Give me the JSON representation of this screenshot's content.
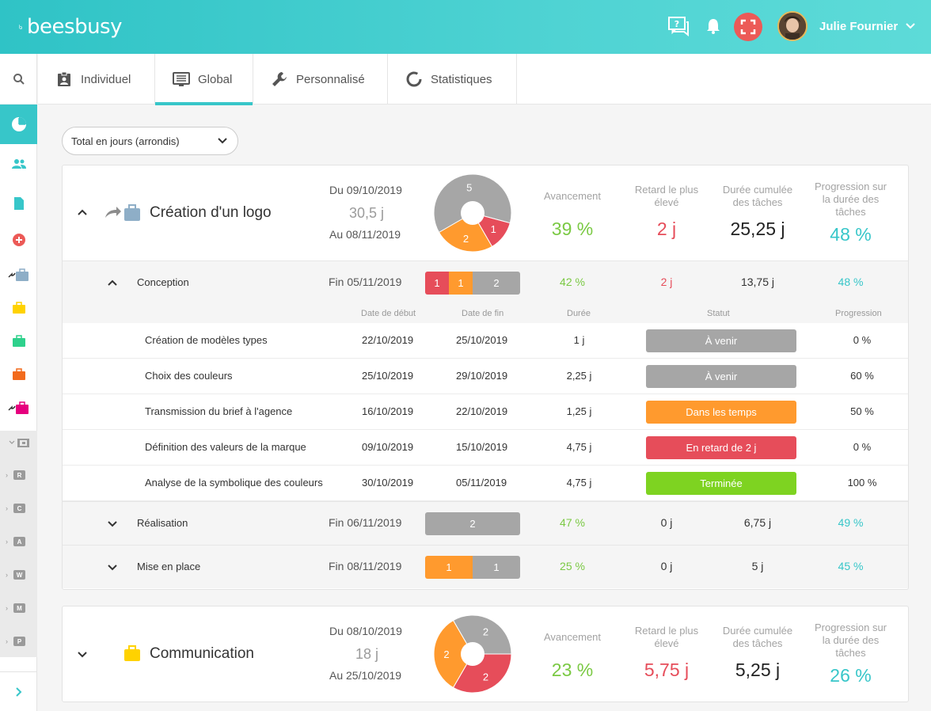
{
  "app": {
    "name": "beesbusy"
  },
  "user": {
    "name": "Julie Fournier"
  },
  "colors": {
    "accent": "#37c6c9",
    "green": "#7ac943",
    "red": "#e64d5a",
    "orange": "#ff9a2e",
    "gray": "#a6a6a6"
  },
  "tabs": [
    {
      "label": "Individuel",
      "icon": "clipboard-user-icon"
    },
    {
      "label": "Global",
      "icon": "list-screen-icon",
      "active": true
    },
    {
      "label": "Personnalisé",
      "icon": "wrench-icon"
    },
    {
      "label": "Statistiques",
      "icon": "donut-chart-icon"
    }
  ],
  "sidebar": {
    "letters": [
      "R",
      "C",
      "A",
      "W",
      "M",
      "P"
    ]
  },
  "filter": {
    "selected": "Total en jours (arrondis)"
  },
  "kpi_labels": {
    "avancement": "Avancement",
    "retard_line1": "Retard le plus",
    "retard_line2": "élevé",
    "duree_line1": "Durée cumulée",
    "duree_line2": "des tâches",
    "progression_line1": "Progression sur",
    "progression_line2": "la durée des",
    "progression_line3": "tâches"
  },
  "table_headers": {
    "start": "Date de début",
    "end": "Date de fin",
    "duration": "Durée",
    "status": "Statut",
    "progress": "Progression"
  },
  "projects": [
    {
      "name": "Création d'un logo",
      "date_start": "Du 09/10/2019",
      "duration": "30,5 j",
      "date_end": "Au 08/11/2019",
      "pie": [
        {
          "value": 5,
          "color": "#a6a6a6"
        },
        {
          "value": 1,
          "color": "#e64d5a"
        },
        {
          "value": 2,
          "color": "#ff9a2e"
        }
      ],
      "pie_labels": [
        "5",
        "1",
        "2"
      ],
      "avancement": "39 %",
      "retard": "2 j",
      "duree": "25,25 j",
      "progression": "48 %",
      "subprojects": [
        {
          "name": "Conception",
          "fin": "Fin 05/11/2019",
          "bar": [
            {
              "label": "1",
              "color": "#e64d5a"
            },
            {
              "label": "1",
              "color": "#ff9a2e"
            },
            {
              "label": "2",
              "color": "#a6a6a6"
            }
          ],
          "avancement": "42 %",
          "retard": "2 j",
          "duree": "13,75 j",
          "progression": "48 %",
          "tasks": [
            {
              "name": "Création de modèles types",
              "start": "22/10/2019",
              "end": "25/10/2019",
              "duration": "1 j",
              "status": "À venir",
              "status_color": "#a6a6a6",
              "progress": "0 %"
            },
            {
              "name": "Choix des couleurs",
              "start": "25/10/2019",
              "end": "29/10/2019",
              "duration": "2,25 j",
              "status": "À venir",
              "status_color": "#a6a6a6",
              "progress": "60 %"
            },
            {
              "name": "Transmission du brief à l'agence",
              "start": "16/10/2019",
              "end": "22/10/2019",
              "duration": "1,25 j",
              "status": "Dans les temps",
              "status_color": "#ff9a2e",
              "progress": "50 %"
            },
            {
              "name": "Définition des valeurs de la marque",
              "start": "09/10/2019",
              "end": "15/10/2019",
              "duration": "4,75 j",
              "status": "En retard de 2 j",
              "status_color": "#e64d5a",
              "progress": "0 %"
            },
            {
              "name": "Analyse de la symbolique des couleurs",
              "start": "30/10/2019",
              "end": "05/11/2019",
              "duration": "4,75 j",
              "status": "Terminée",
              "status_color": "#7ed321",
              "progress": "100 %"
            }
          ]
        },
        {
          "name": "Réalisation",
          "fin": "Fin 06/11/2019",
          "bar": [
            {
              "label": "2",
              "color": "#a6a6a6"
            }
          ],
          "avancement": "47 %",
          "retard": "0 j",
          "duree": "6,75 j",
          "progression": "49 %"
        },
        {
          "name": "Mise en place",
          "fin": "Fin 08/11/2019",
          "bar": [
            {
              "label": "1",
              "color": "#ff9a2e"
            },
            {
              "label": "1",
              "color": "#a6a6a6"
            }
          ],
          "avancement": "25 %",
          "retard": "0 j",
          "duree": "5 j",
          "progression": "45 %"
        }
      ]
    },
    {
      "name": "Communication",
      "date_start": "Du 08/10/2019",
      "duration": "18 j",
      "date_end": "Au 25/10/2019",
      "pie": [
        {
          "value": 2,
          "color": "#a6a6a6"
        },
        {
          "value": 2,
          "color": "#e64d5a"
        },
        {
          "value": 2,
          "color": "#ff9a2e"
        }
      ],
      "pie_labels": [
        "2",
        "2",
        "2"
      ],
      "avancement": "23 %",
      "retard": "5,75 j",
      "duree": "5,25 j",
      "progression": "26 %"
    }
  ]
}
